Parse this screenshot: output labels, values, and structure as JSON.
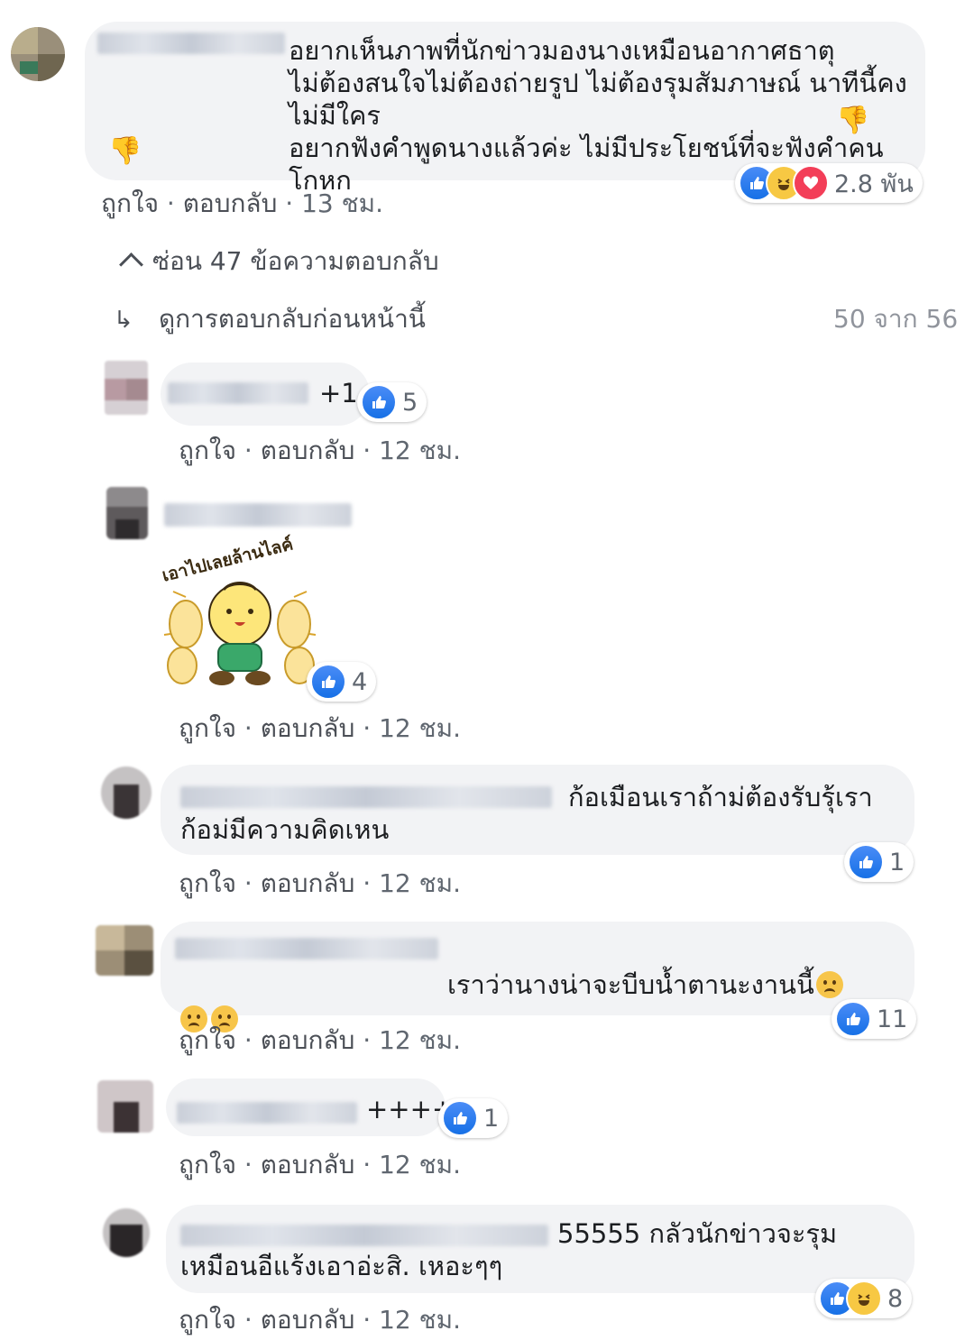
{
  "top_comment": {
    "text": "อยากเห็นภาพที่นักข่าวมองนางเหมือนอากาศธาตุ\nไม่ต้องสนใจไม่ต้องถ่ายรูป ไม่ต้องรุมสัมภาษณ์ นาทีนี้คงไม่มีใคร\nอยากฟังคำพูดนางแล้วค่ะ ไม่มีประโยชน์ที่จะฟังคำคนโกหก",
    "reaction_count": "2.8 พัน",
    "reactions": [
      "like-icon",
      "haha-icon",
      "love-icon"
    ],
    "emoji": "thumbs-down-icon",
    "actions": {
      "like": "ถูกใจ",
      "reply": "ตอบกลับ",
      "time": "13 ชม."
    }
  },
  "hide_replies_label": "ซ่อน 47 ข้อความตอบกลับ",
  "view_previous_label": "ดูการตอบกลับก่อนหน้านี้",
  "reply_pagination": "50 จาก 56",
  "separator": "·",
  "replies": [
    {
      "text": "+1",
      "reaction_count": "5",
      "reactions": [
        "like-icon"
      ],
      "actions": {
        "like": "ถูกใจ",
        "reply": "ตอบกลับ",
        "time": "12 ชม."
      }
    },
    {
      "text": "",
      "sticker_caption": "เอาไปเลยล้านไลค์",
      "reaction_count": "4",
      "reactions": [
        "like-icon"
      ],
      "actions": {
        "like": "ถูกใจ",
        "reply": "ตอบกลับ",
        "time": "12 ชม."
      }
    },
    {
      "text": "ก้อเมือนเราถ้าม่ต้องรับรุ้เรา\nก้อม่มีความคิดเหน",
      "reaction_count": "1",
      "reactions": [
        "like-icon"
      ],
      "actions": {
        "like": "ถูกใจ",
        "reply": "ตอบกลับ",
        "time": "12 ชม."
      }
    },
    {
      "text": "เราว่านางน่าจะบีบน้ำตานะงานนี้",
      "emoji": "sad-face-icon",
      "reaction_count": "11",
      "reactions": [
        "like-icon"
      ],
      "actions": {
        "like": "ถูกใจ",
        "reply": "ตอบกลับ",
        "time": "12 ชม."
      }
    },
    {
      "text": "++++",
      "reaction_count": "1",
      "reactions": [
        "like-icon"
      ],
      "actions": {
        "like": "ถูกใจ",
        "reply": "ตอบกลับ",
        "time": "12 ชม."
      }
    },
    {
      "text": "55555 กลัวนักข่าวจะรุม\nเหมือนอีแร้งเอาอ่ะสิ. เหอะๆๆ",
      "reaction_count": "8",
      "reactions": [
        "like-icon",
        "haha-icon"
      ],
      "actions": {
        "like": "ถูกใจ",
        "reply": "ตอบกลับ",
        "time": "12 ชม."
      }
    }
  ],
  "colors": {
    "bubble": "#f2f3f5",
    "like": "#1877f2",
    "meta": "#606770"
  }
}
